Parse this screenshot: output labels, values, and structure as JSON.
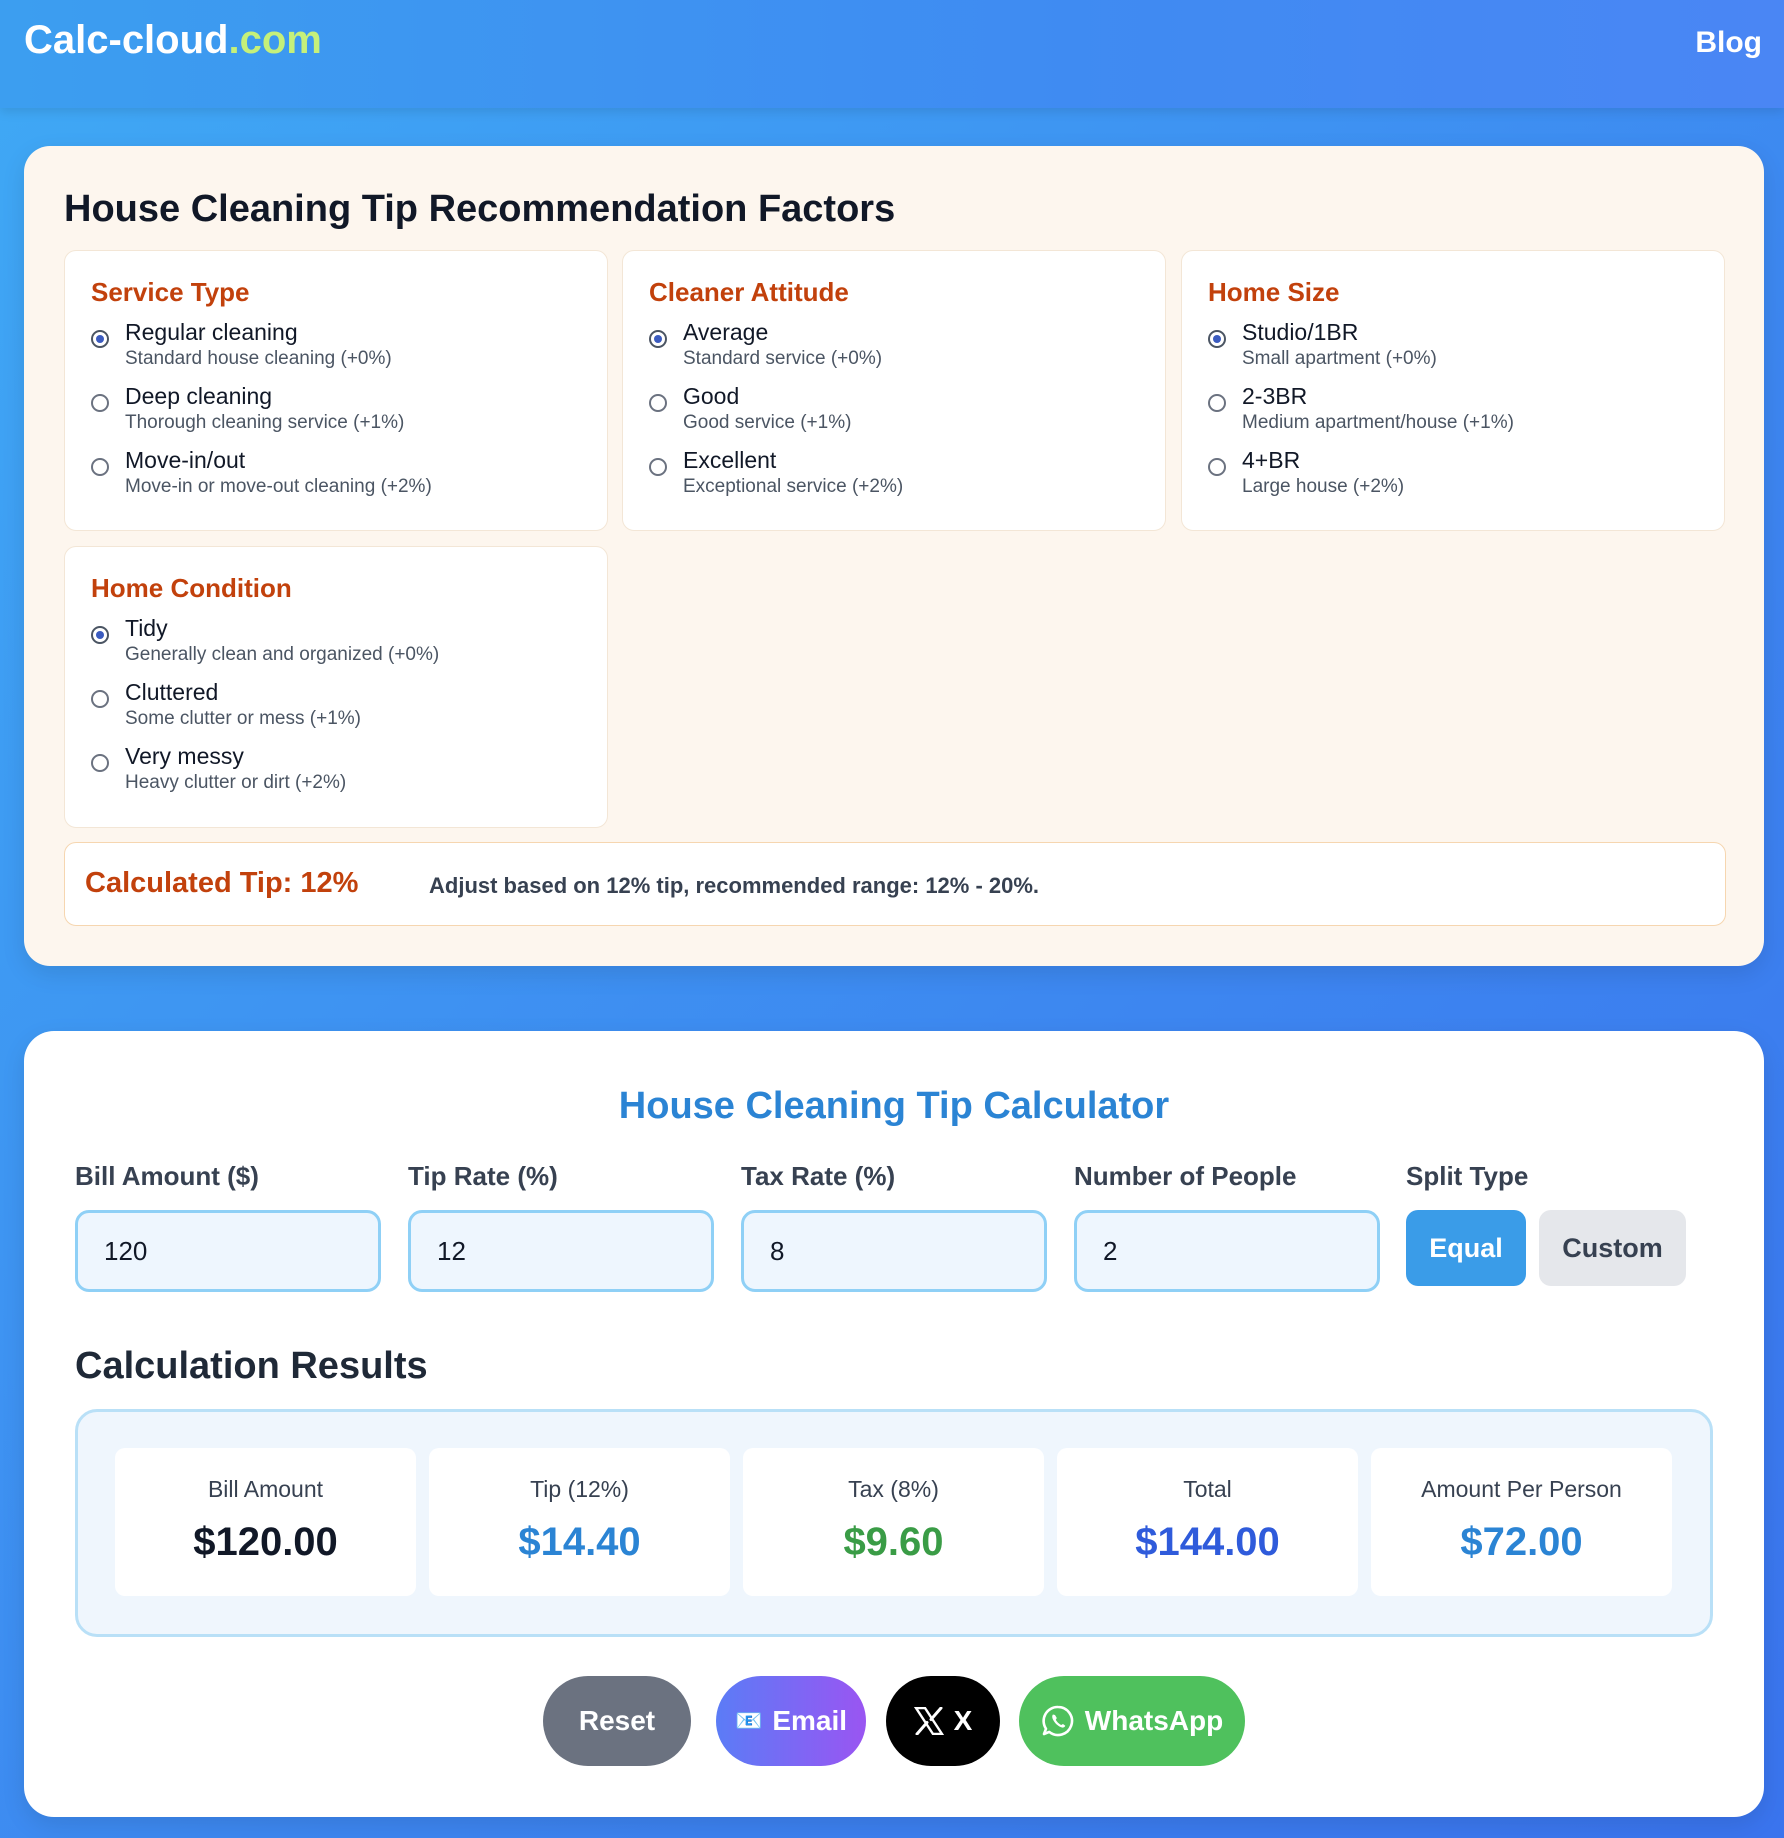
{
  "header": {
    "logo_main": "Calc-cloud",
    "logo_tld": ".com",
    "blog_label": "Blog"
  },
  "factors": {
    "title": "House Cleaning Tip Recommendation Factors",
    "service_type": {
      "heading": "Service Type",
      "options": [
        {
          "label": "Regular cleaning",
          "desc": "Standard house cleaning (+0%)",
          "checked": true
        },
        {
          "label": "Deep cleaning",
          "desc": "Thorough cleaning service (+1%)",
          "checked": false
        },
        {
          "label": "Move-in/out",
          "desc": "Move-in or move-out cleaning (+2%)",
          "checked": false
        }
      ]
    },
    "cleaner_attitude": {
      "heading": "Cleaner Attitude",
      "options": [
        {
          "label": "Average",
          "desc": "Standard service (+0%)",
          "checked": true
        },
        {
          "label": "Good",
          "desc": "Good service (+1%)",
          "checked": false
        },
        {
          "label": "Excellent",
          "desc": "Exceptional service (+2%)",
          "checked": false
        }
      ]
    },
    "home_size": {
      "heading": "Home Size",
      "options": [
        {
          "label": "Studio/1BR",
          "desc": "Small apartment (+0%)",
          "checked": true
        },
        {
          "label": "2-3BR",
          "desc": "Medium apartment/house (+1%)",
          "checked": false
        },
        {
          "label": "4+BR",
          "desc": "Large house (+2%)",
          "checked": false
        }
      ]
    },
    "home_condition": {
      "heading": "Home Condition",
      "options": [
        {
          "label": "Tidy",
          "desc": "Generally clean and organized (+0%)",
          "checked": true
        },
        {
          "label": "Cluttered",
          "desc": "Some clutter or mess (+1%)",
          "checked": false
        },
        {
          "label": "Very messy",
          "desc": "Heavy clutter or dirt (+2%)",
          "checked": false
        }
      ]
    },
    "calculated_tip_label": "Calculated Tip: 12%",
    "calculated_tip_note": "Adjust based on 12% tip, recommended range: 12% - 20%."
  },
  "calculator": {
    "title": "House Cleaning Tip Calculator",
    "bill_label": "Bill Amount ($)",
    "bill_value": "120",
    "tip_label": "Tip Rate (%)",
    "tip_value": "12",
    "tax_label": "Tax Rate (%)",
    "tax_value": "8",
    "people_label": "Number of People",
    "people_value": "2",
    "split_label": "Split Type",
    "split_equal": "Equal",
    "split_custom": "Custom",
    "split_selected": "Equal"
  },
  "results": {
    "title": "Calculation Results",
    "items": [
      {
        "label": "Bill Amount",
        "value": "$120.00"
      },
      {
        "label": "Tip (12%)",
        "value": "$14.40"
      },
      {
        "label": "Tax (8%)",
        "value": "$9.60"
      },
      {
        "label": "Total",
        "value": "$144.00"
      },
      {
        "label": "Amount Per Person",
        "value": "$72.00"
      }
    ]
  },
  "actions": {
    "reset": "Reset",
    "email": "Email",
    "email_icon": "📧",
    "x": "X",
    "whatsapp": "WhatsApp"
  },
  "colors": {
    "accent_blue": "#2b84d4",
    "accent_orange": "#c2410c",
    "result_dark": "#111827",
    "result_blue": "#2b84d4",
    "result_green": "#3a9c46",
    "result_indigo": "#2f5bdb"
  },
  "icons": {
    "x_logo": "x-logo-icon",
    "whatsapp": "whatsapp-icon",
    "email": "email-icon"
  }
}
